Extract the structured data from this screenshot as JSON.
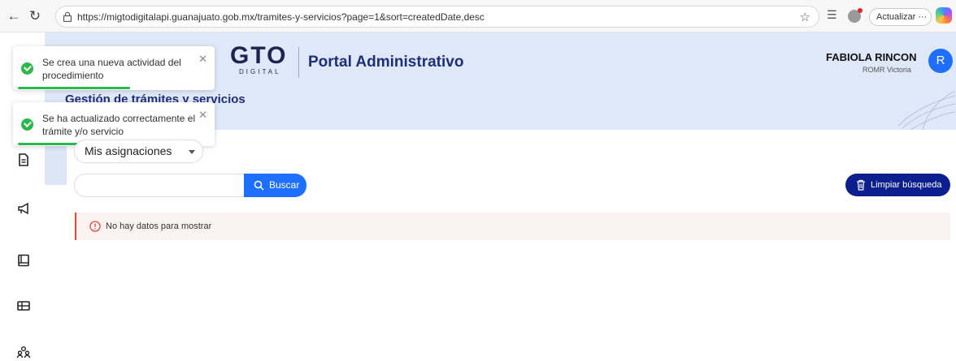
{
  "browser": {
    "url": "https://migtodigitalapi.guanajuato.gob.mx/tramites-y-servicios?page=1&sort=createdDate,desc",
    "update_label": "Actualizar"
  },
  "header": {
    "logo_main": "GTO",
    "logo_sub": "DIGITAL",
    "portal_title": "Portal Administrativo",
    "section_title": "Gestión de trámites y servicios",
    "user_name": "FABIOLA RINCON",
    "user_subtitle": "ROMR Victoria",
    "avatar_letter": "R"
  },
  "toasts": [
    {
      "message": "Se crea una nueva actividad del procedimiento"
    },
    {
      "message": "Se ha actualizado correctamente el trámite y/o servicio"
    }
  ],
  "filters": {
    "select_value": "Mis asignaciones",
    "search_placeholder": "",
    "search_button": "Buscar",
    "clear_button": "Limpiar búsqueda"
  },
  "results": {
    "empty_message": "No hay datos para mostrar"
  },
  "colors": {
    "primary": "#1f6fff",
    "dark_primary": "#0d1f8f",
    "header_bg": "#dfe8f8",
    "success": "#2bb84a",
    "error": "#e04a3a"
  }
}
